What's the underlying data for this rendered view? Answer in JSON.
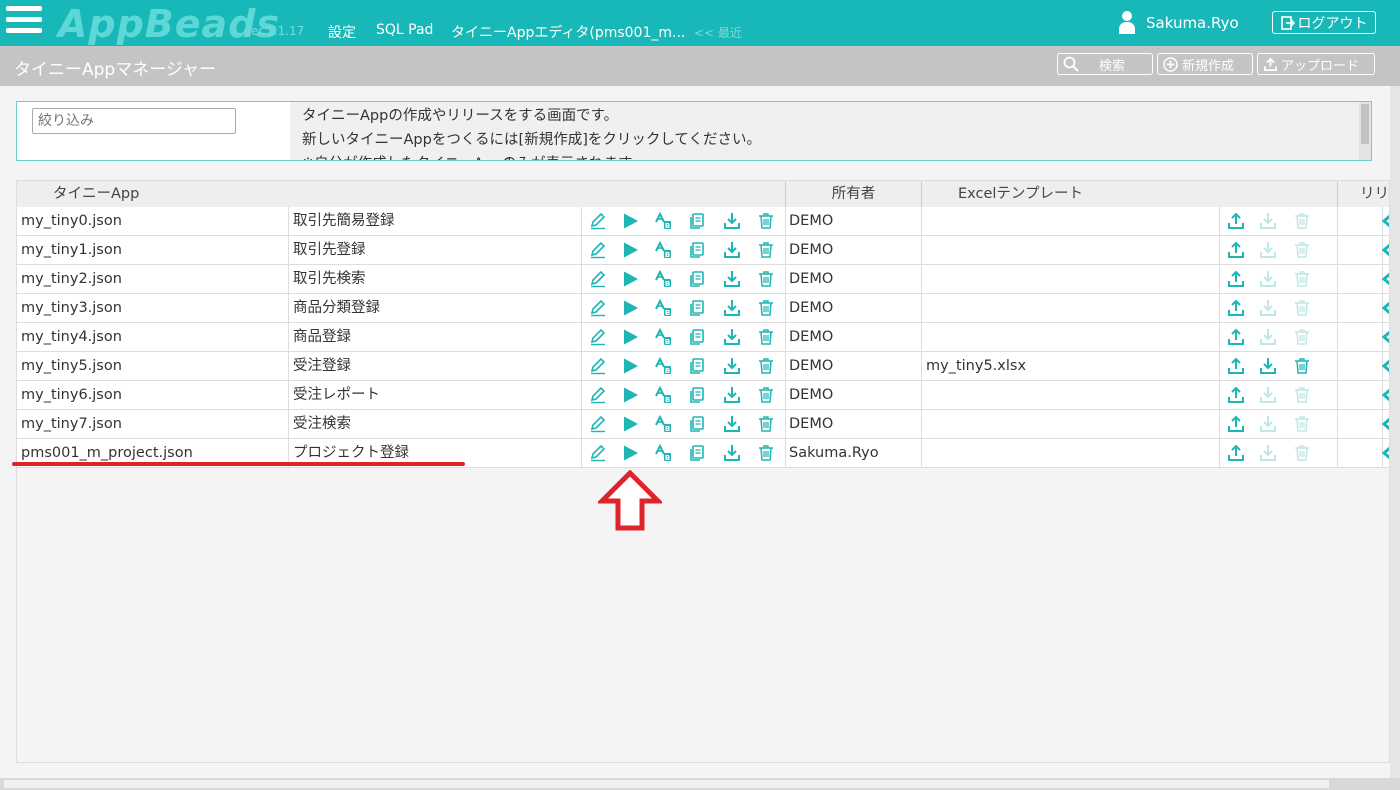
{
  "header": {
    "logo": "AppBeads",
    "version": "ver.1.1.17",
    "nav": [
      "設定",
      "SQL Pad",
      "タイニーAppエディタ(pms001_m...",
      "<< 最近"
    ],
    "user_name": "Sakuma.Ryo",
    "logout_label": "ログアウト"
  },
  "subheader": {
    "title": "タイニーAppマネージャー",
    "search_label": "検索",
    "new_label": "新規作成",
    "upload_label": "アップロード"
  },
  "info": {
    "filter_placeholder": "絞り込み",
    "lines": [
      "タイニーAppの作成やリリースをする画面です。",
      "新しいタイニーAppをつくるには[新規作成]をクリックしてください。",
      "※自分が作成したタイニーAppのみが表示されます。"
    ]
  },
  "table": {
    "headers": {
      "app": "タイニーApp",
      "owner": "所有者",
      "excel": "Excelテンプレート",
      "release": "リリース"
    },
    "rows": [
      {
        "file": "my_tiny0.json",
        "name": "取引先簡易登録",
        "owner": "DEMO",
        "excel": "",
        "has_excel": false
      },
      {
        "file": "my_tiny1.json",
        "name": "取引先登録",
        "owner": "DEMO",
        "excel": "",
        "has_excel": false
      },
      {
        "file": "my_tiny2.json",
        "name": "取引先検索",
        "owner": "DEMO",
        "excel": "",
        "has_excel": false
      },
      {
        "file": "my_tiny3.json",
        "name": "商品分類登録",
        "owner": "DEMO",
        "excel": "",
        "has_excel": false
      },
      {
        "file": "my_tiny4.json",
        "name": "商品登録",
        "owner": "DEMO",
        "excel": "",
        "has_excel": false
      },
      {
        "file": "my_tiny5.json",
        "name": "受注登録",
        "owner": "DEMO",
        "excel": "my_tiny5.xlsx",
        "has_excel": true
      },
      {
        "file": "my_tiny6.json",
        "name": "受注レポート",
        "owner": "DEMO",
        "excel": "",
        "has_excel": false
      },
      {
        "file": "my_tiny7.json",
        "name": "受注検索",
        "owner": "DEMO",
        "excel": "",
        "has_excel": false
      },
      {
        "file": "pms001_m_project.json",
        "name": "プロジェクト登録",
        "owner": "Sakuma.Ryo",
        "excel": "",
        "has_excel": false
      }
    ]
  },
  "colors": {
    "accent": "#19b8b8",
    "icon": "#1fb5b5",
    "icon_disabled": "#bfe7e7",
    "annotation": "#e0232a"
  }
}
